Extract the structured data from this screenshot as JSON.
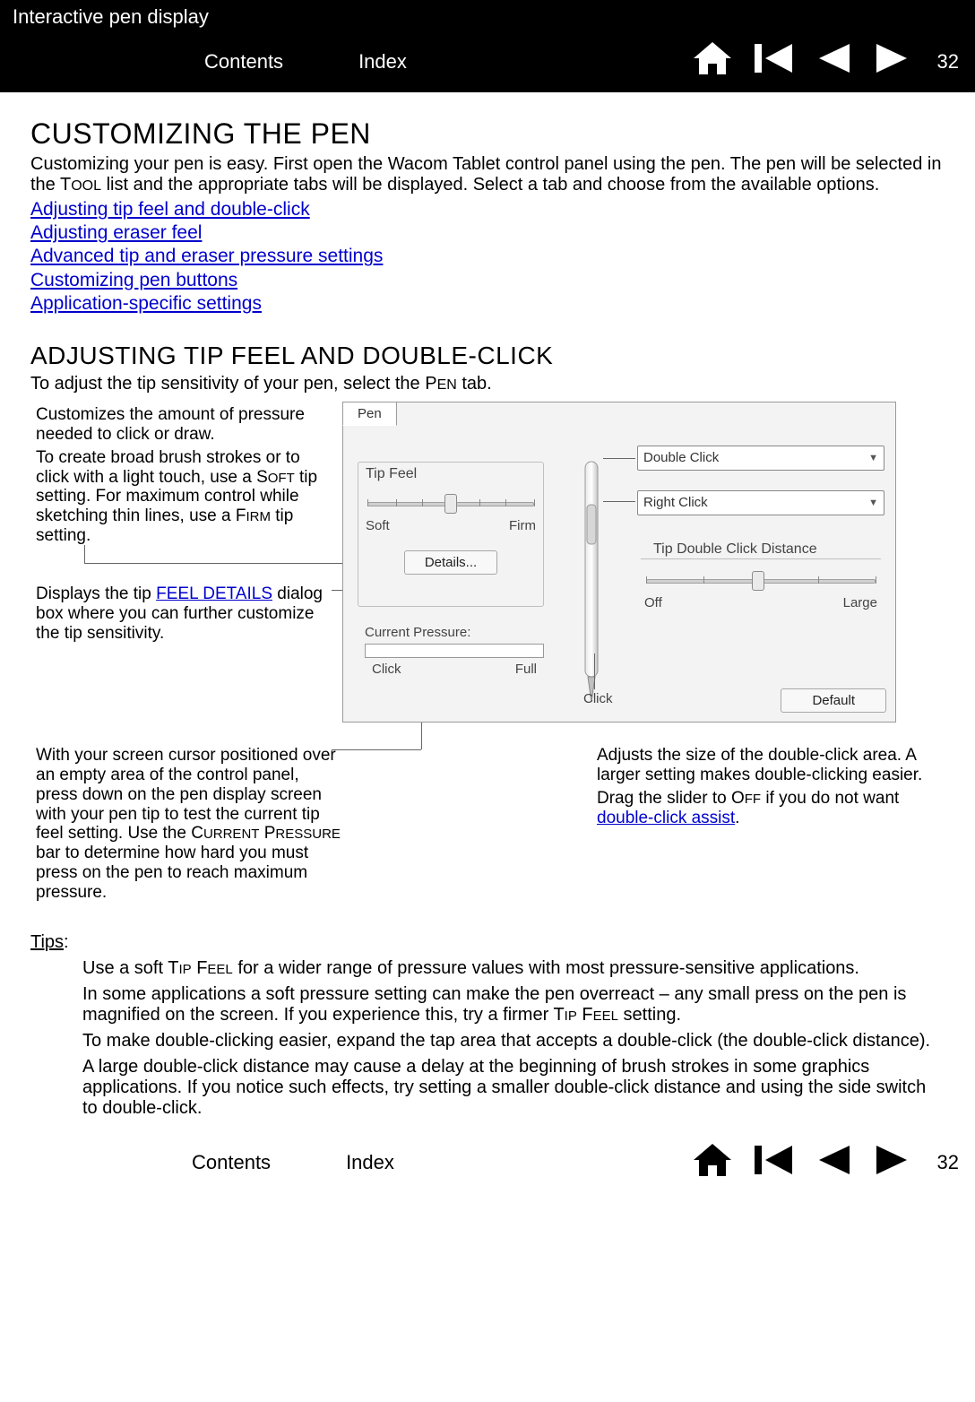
{
  "header": {
    "title": "Interactive pen display",
    "contents": "Contents",
    "index": "Index",
    "page": "32"
  },
  "section1": {
    "title": "CUSTOMIZING THE PEN",
    "intro_a": "Customizing your pen is easy.  First open the Wacom Tablet control panel using the pen.  The pen will be selected in the T",
    "intro_sc1": "OOL",
    "intro_b": " list and the appropriate tabs will be displayed.  Select a tab and choose from the available options."
  },
  "toc": {
    "l1": "Adjusting tip feel and double-click",
    "l2": "Adjusting eraser feel",
    "l3": "Advanced tip and eraser pressure settings",
    "l4": "Customizing pen buttons",
    "l5": "Application-specific settings"
  },
  "section2": {
    "title": "ADJUSTING TIP FEEL AND DOUBLE-CLICK",
    "intro_a": "To adjust the tip sensitivity of your pen, select the P",
    "intro_sc1": "EN",
    "intro_b": " tab."
  },
  "callouts": {
    "c1a": "Customizes the amount of pressure needed to click or draw.",
    "c1b_a": "To create broad brush strokes or to click with a light touch, use a S",
    "c1b_sc": "OFT",
    "c1b_b": " tip setting.  For maximum control while sketching thin lines, use a F",
    "c1b_sc2": "IRM",
    "c1b_c": " tip setting.",
    "c2a": "Displays the tip ",
    "c2link": "FEEL DETAILS",
    "c2b": " dialog box where you can further customize the tip sensitivity.",
    "c3_a": "With your screen cursor positioned over an empty area of the control panel, press down on the pen display screen with your pen tip to test the current tip feel setting.  Use the C",
    "c3_sc1": "URRENT",
    "c3_mid": " P",
    "c3_sc2": "RESSURE",
    "c3_b": " bar to determine how hard you must press on the pen to reach maximum pressure.",
    "c4a": "Adjusts the size of the double-click area.  A larger setting makes double-clicking easier.",
    "c4b_a": "Drag the slider to O",
    "c4b_sc": "FF",
    "c4b_b": " if you do not want ",
    "c4b_link": "double-click assist",
    "c4b_c": "."
  },
  "panel": {
    "tab": "Pen",
    "tipfeel": "Tip Feel",
    "soft": "Soft",
    "firm": "Firm",
    "details": "Details...",
    "curpress": "Current Pressure:",
    "click": "Click",
    "full": "Full",
    "dbl": "Double Click",
    "rclick": "Right Click",
    "tdcd": "Tip Double Click Distance",
    "off": "Off",
    "large": "Large",
    "click2": "Click",
    "default": "Default"
  },
  "tips": {
    "hdr": "Tips",
    "colon": ":",
    "t1_a": "Use a soft T",
    "t1_sc1": "IP",
    "t1_mid": " F",
    "t1_sc2": "EEL",
    "t1_b": " for a wider range of pressure values with most pressure-sensitive applications.",
    "t2_a": "In some applications a soft pressure setting can make the pen overreact – any small press on the pen is magnified on the screen.  If you experience this, try a firmer T",
    "t2_sc1": "IP",
    "t2_mid": " F",
    "t2_sc2": "EEL",
    "t2_b": " setting.",
    "t3": "To make double-clicking easier, expand the tap area that accepts a double-click (the double-click distance).",
    "t4": "A large double-click distance may cause a delay at the beginning of brush strokes in some graphics applications.  If you notice such effects, try setting a smaller double-click distance and using the side switch to double-click."
  },
  "footer": {
    "contents": "Contents",
    "index": "Index",
    "page": "32"
  }
}
